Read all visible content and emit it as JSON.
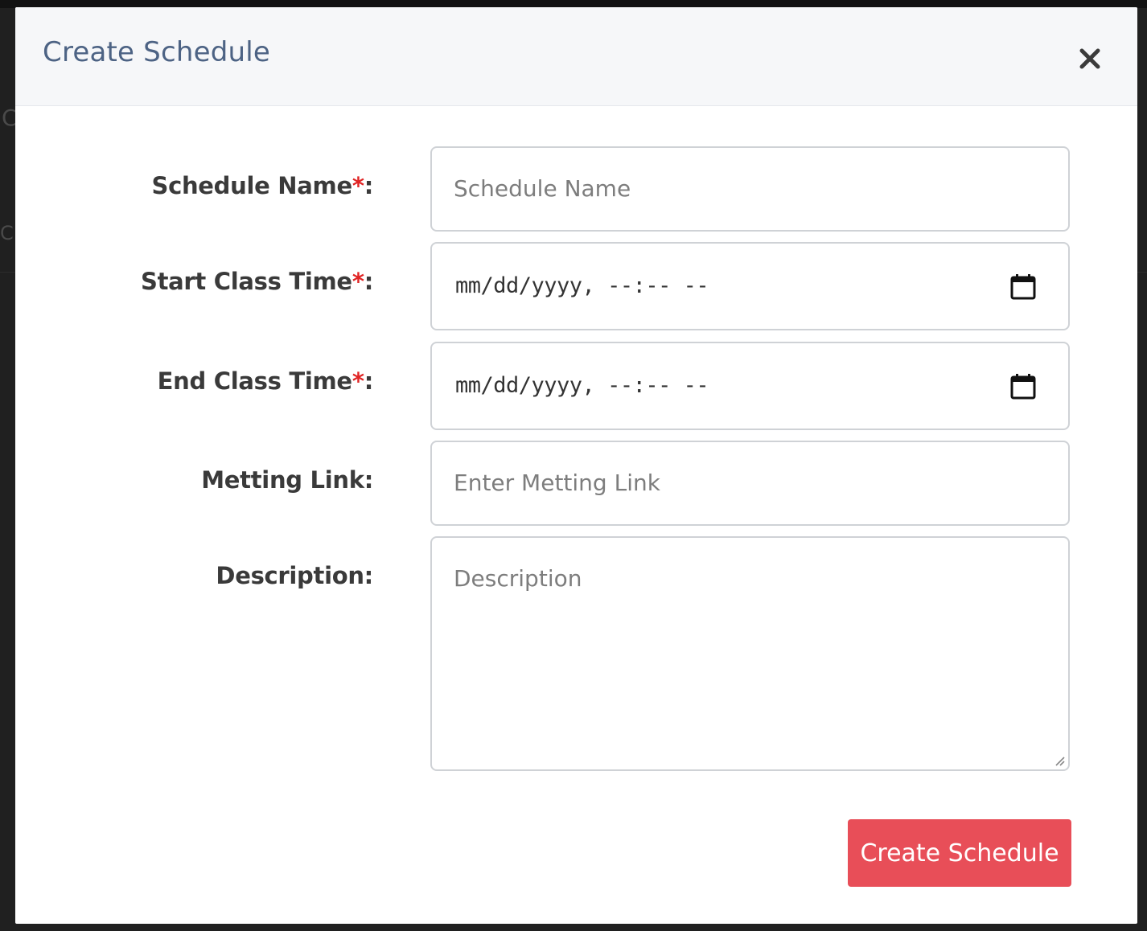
{
  "modal": {
    "title": "Create Schedule",
    "close_symbol": "×",
    "close_icon": "close-icon"
  },
  "form": {
    "schedule_name": {
      "label": "Schedule Name",
      "required_mark": "*",
      "suffix": ":",
      "placeholder": "Schedule Name",
      "value": ""
    },
    "start_time": {
      "label": "Start Class Time",
      "required_mark": "*",
      "suffix": ":",
      "display_value": "mm/dd/yyyy, --:-- --",
      "icon": "calendar-icon"
    },
    "end_time": {
      "label": "End Class Time",
      "required_mark": "*",
      "suffix": ":",
      "display_value": "mm/dd/yyyy, --:-- --",
      "icon": "calendar-icon"
    },
    "meeting_link": {
      "label": "Metting Link:",
      "placeholder": "Enter Metting Link",
      "value": ""
    },
    "description": {
      "label": "Description:",
      "placeholder": "Description",
      "value": ""
    }
  },
  "actions": {
    "submit_label": "Create Schedule"
  },
  "colors": {
    "title": "#4d6384",
    "required": "#e02424",
    "submit_bg": "#e84e58",
    "header_bg": "#f6f7f9",
    "field_border": "#cfd2d6"
  }
}
